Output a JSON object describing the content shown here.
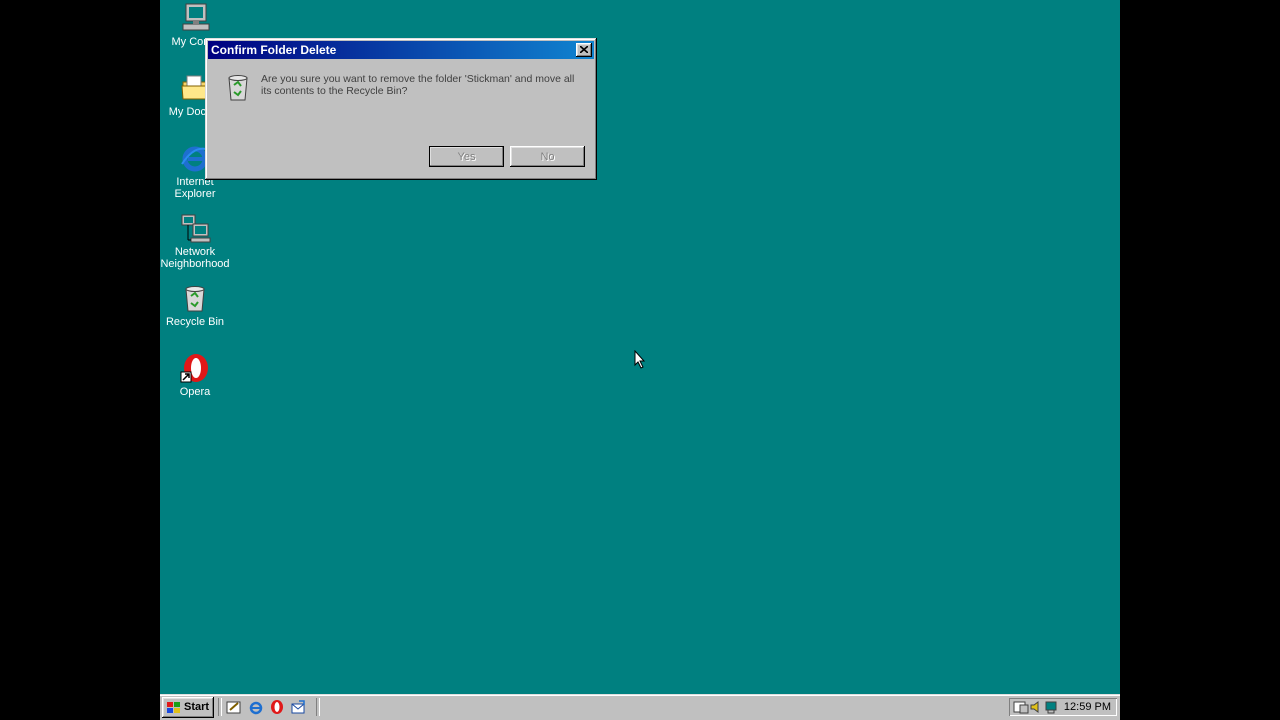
{
  "desktop": {
    "icons": [
      {
        "label": "My Comp",
        "icon": "my-computer-icon"
      },
      {
        "label": "My Docum",
        "icon": "my-documents-icon"
      },
      {
        "label": "Internet\nExplorer",
        "icon": "internet-explorer-icon"
      },
      {
        "label": "Network\nNeighborhood",
        "icon": "network-neighborhood-icon"
      },
      {
        "label": "Recycle Bin",
        "icon": "recycle-bin-icon"
      },
      {
        "label": "Opera",
        "icon": "opera-icon"
      }
    ],
    "background_color": "#008080"
  },
  "dialog": {
    "title": "Confirm Folder Delete",
    "message": "Are you sure you want to remove the folder 'Stickman' and move all its contents to the Recycle Bin?",
    "yes_label": "Yes",
    "no_label": "No",
    "icon": "recycle-bin-icon"
  },
  "taskbar": {
    "start_label": "Start",
    "quick_launch": [
      "show-desktop-icon",
      "internet-explorer-icon",
      "opera-icon",
      "outlook-express-icon"
    ],
    "tray_icons": [
      "scheduler-icon",
      "volume-icon",
      "display-icon"
    ],
    "clock": "12:59 PM"
  }
}
